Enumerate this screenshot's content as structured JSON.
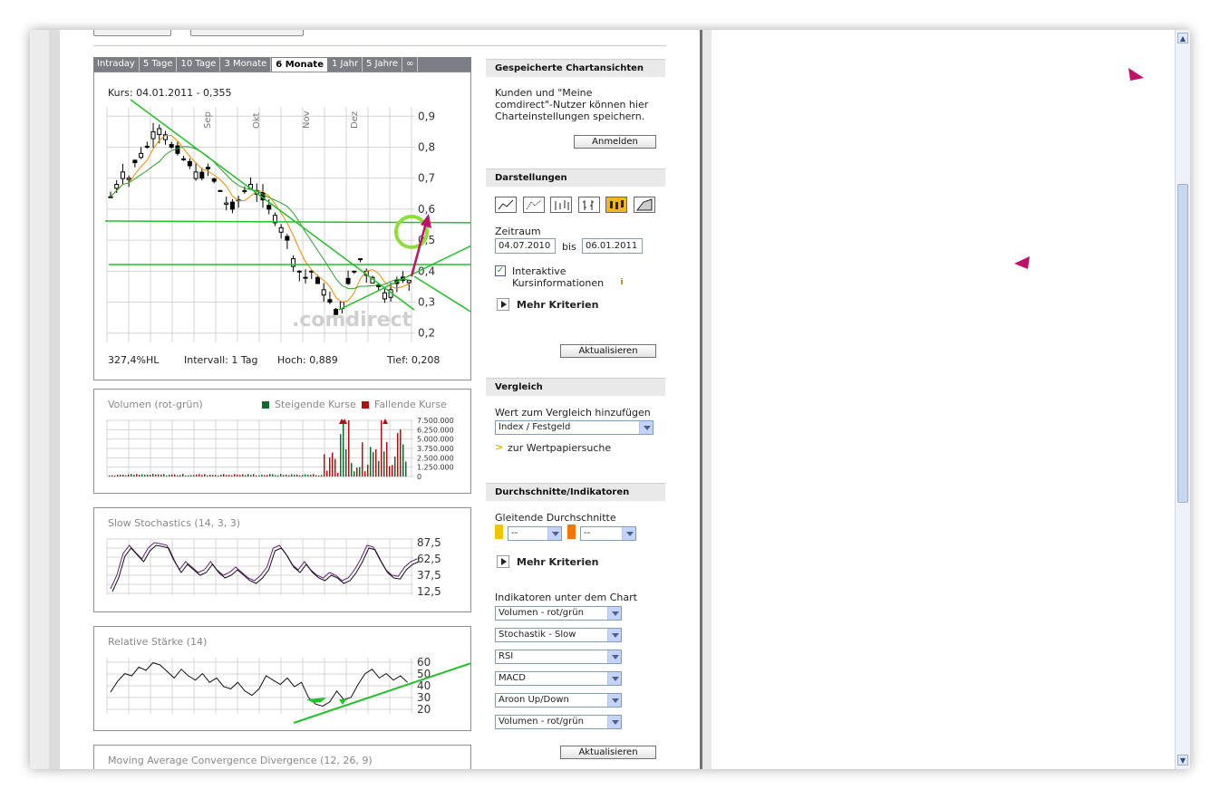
{
  "tabs": [
    "Intraday",
    "5 Tage",
    "10 Tage",
    "3 Monate",
    "6 Monate",
    "1 Jahr",
    "5 Jahre",
    "∞"
  ],
  "active_tab": "6 Monate",
  "main_chart": {
    "kurs_label": "Kurs: 04.01.2011 - 0,355",
    "months": [
      "Sep",
      "Okt",
      "Nov",
      "Dez"
    ],
    "y_ticks": [
      "0,9",
      "0,8",
      "0,7",
      "0,6",
      "0,5",
      "0,4",
      "0,3",
      "0,2"
    ],
    "watermark": ".comdirect",
    "stats": {
      "hl": "327,4%HL",
      "intervall": "Intervall: 1 Tag",
      "hoch": "Hoch:  0,889",
      "tief": "Tief:  0,208"
    }
  },
  "volume": {
    "title": "Volumen (rot-grün)",
    "legend_up": "Steigende Kurse",
    "legend_down": "Fallende Kurse",
    "y_ticks": [
      "7.500.000",
      "6.250.000",
      "5.000.000",
      "3.750.000",
      "2.500.000",
      "1.250.000",
      "0"
    ]
  },
  "stochastics": {
    "title": "Slow Stochastics (14, 3, 3)",
    "y_ticks": [
      "87,5",
      "62,5",
      "37,5",
      "12,5"
    ]
  },
  "rsi": {
    "title": "Relative Stärke (14)",
    "y_ticks": [
      "60",
      "50",
      "40",
      "30",
      "20"
    ]
  },
  "macd": {
    "title": "Moving Average Convergence Divergence (12, 26, 9)"
  },
  "sidebar": {
    "saved_views_header": "Gespeicherte Chartansichten",
    "saved_views_text": [
      "Kunden und \"Meine",
      "comdirect\"-Nutzer können hier",
      "Charteinstellungen speichern."
    ],
    "login_button": "Anmelden",
    "views_header": "Darstellungen",
    "zeitraum_label": "Zeitraum",
    "date_from": "04.07.2010",
    "bis_label": "bis",
    "date_to": "06.01.2011",
    "interactive_label": [
      "Interaktive",
      "Kursinformationen"
    ],
    "more_criteria": "Mehr Kriterien",
    "update_button": "Aktualisieren",
    "compare_header": "Vergleich",
    "compare_text": "Wert zum Vergleich hinzufügen",
    "compare_select": "Index / Festgeld",
    "search_link": "zur Wertpapiersuche",
    "indicators_header": "Durchschnitte/Indikatoren",
    "moving_avg_label": "Gleitende Durchschnitte",
    "ma_select_1": "--",
    "ma_select_2": "--",
    "more_criteria_2": "Mehr Kriterien",
    "indicators_label": "Indikatoren unter dem Chart",
    "indicator_selects": [
      "Volumen - rot/grün",
      "Stochastik - Slow",
      "RSI",
      "MACD",
      "Aroon Up/Down",
      "Volumen - rot/grün"
    ],
    "update_button_2": "Aktualisieren"
  },
  "colors": {
    "ma_yellow": "#f5c400",
    "ma_orange": "#f07800",
    "trend_green": "#22c02a",
    "annotation_magenta": "#c0106a",
    "tab_bar": "#7d7d85"
  }
}
